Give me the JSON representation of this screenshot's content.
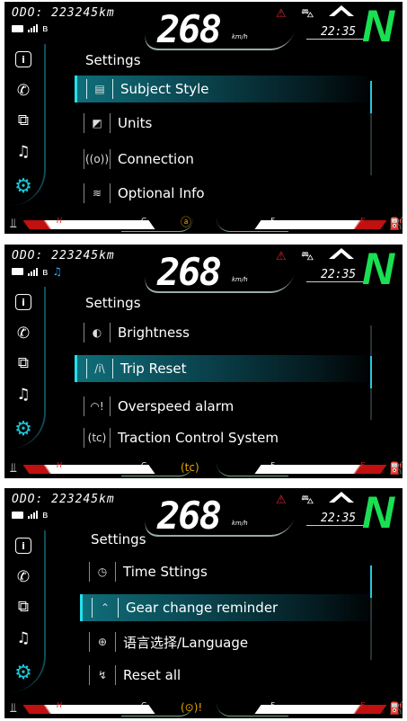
{
  "screens": [
    {
      "odo": "ODO: 223245km",
      "speed": "268",
      "speed_unit": "km/h",
      "time": "22:35",
      "gear": "N",
      "show_music": false,
      "tc_icon": "ⓐ",
      "settings_title": "Settings",
      "menu_items": [
        {
          "label": "Subject Style",
          "icon": "▤",
          "selected": true
        },
        {
          "label": "Units",
          "icon": "◩",
          "selected": false
        },
        {
          "label": "Connection",
          "icon": "((o))",
          "selected": false
        },
        {
          "label": "Optional Info",
          "icon": "≋",
          "selected": false
        }
      ],
      "scroll_fraction": 0.0
    },
    {
      "odo": "ODO: 223245km",
      "speed": "268",
      "speed_unit": "km/h",
      "time": "22:35",
      "gear": "N",
      "show_music": true,
      "tc_icon": "(tc)",
      "settings_title": "Settings",
      "menu_items": [
        {
          "label": "Brightness",
          "icon": "◐",
          "selected": false
        },
        {
          "label": "Trip Reset",
          "icon": "/i\\",
          "selected": true
        },
        {
          "label": "Overspeed alarm",
          "icon": "◠!",
          "selected": false
        },
        {
          "label": "Traction Control System",
          "icon": "(tc)",
          "selected": false
        }
      ],
      "scroll_fraction": 0.33
    },
    {
      "odo": "ODO: 223245km",
      "speed": "268",
      "speed_unit": "km/h",
      "time": "22:35",
      "gear": "N",
      "show_music": false,
      "tc_icon": "(⊙)!",
      "settings_title": "Settings",
      "menu_items": [
        {
          "label": "Time Sttings",
          "icon": "◷",
          "selected": false
        },
        {
          "label": "Gear change reminder",
          "icon": "⌃",
          "selected": true
        },
        {
          "label": "语言选择/Language",
          "icon": "⊕",
          "selected": false
        },
        {
          "label": "Reset all",
          "icon": "↯",
          "selected": false
        }
      ],
      "scroll_fraction": 0.0
    }
  ],
  "colors": {
    "gear": "#19e052",
    "accent": "#22e0ee",
    "warning": "#e0242e",
    "tc": "#e8a400",
    "music": "#2aa8ff"
  },
  "icons": {
    "sidebar": [
      "info-icon",
      "phone-icon",
      "apps-icon",
      "music-icon",
      "settings-gear-icon"
    ],
    "warning": "engine-warning-icon",
    "moto": "motorcycle-icon",
    "fuel": "fuel-pump-icon",
    "temp": "coolant-temp-icon"
  },
  "gauge_marks": {
    "hot": "H",
    "cold": "C",
    "full": "F",
    "empty": "E"
  }
}
